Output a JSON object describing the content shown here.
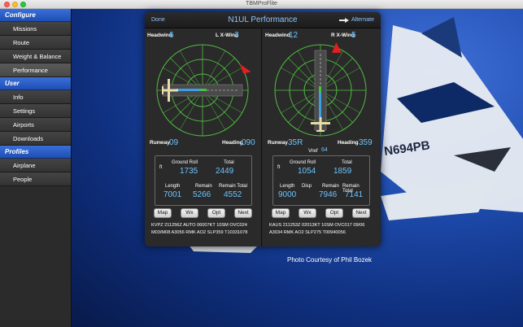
{
  "app": {
    "title": "TBMProFlite"
  },
  "sidebar": {
    "sections": [
      {
        "header": "Configure",
        "items": [
          "Missions",
          "Route",
          "Weight & Balance",
          "Performance"
        ]
      },
      {
        "header": "User",
        "items": [
          "Info",
          "Settings",
          "Airports",
          "Downloads"
        ]
      },
      {
        "header": "Profiles",
        "items": [
          "Airplane",
          "People"
        ]
      }
    ],
    "active_item": "Performance"
  },
  "background": {
    "caption": "Photo Courtesy of Phil Bozek"
  },
  "panel": {
    "done": "Done",
    "title": "N1UL Performance",
    "alternate": "Alternate",
    "left": {
      "headwind_label": "Headwind",
      "headwind": "6",
      "xwind_label": "L X-Wind",
      "xwind": "3",
      "runway_label": "Runway",
      "runway": "09",
      "heading_label": "Heading",
      "heading": "090",
      "unit": "ft",
      "ground_roll_label": "Ground Roll",
      "ground_roll": "1735",
      "total_label": "Total",
      "total": "2449",
      "length_label": "Length",
      "length": "7001",
      "remain_label": "Remain",
      "remain": "5266",
      "remain_total_label": "Remain Total",
      "remain_total": "4552",
      "metar": "KVPZ 211256Z AUTO 06007KT 10SM OVC024\nM03/M08 A3056 RMK AO2 SLP359 T10331078"
    },
    "right": {
      "headwind_label": "Headwind",
      "headwind": "12",
      "xwind_label": "R X-Wind",
      "xwind": "5",
      "runway_label": "Runway",
      "runway": "35R",
      "heading_label": "Heading",
      "heading": "359",
      "vref_label": "Vref",
      "vref": "64",
      "unit": "ft",
      "ground_roll_label": "Ground Roll",
      "ground_roll": "1054",
      "total_label": "Total",
      "total": "1859",
      "length_label": "Length",
      "length": "9000",
      "disp_label": "Disp",
      "remain_label": "Remain",
      "remain": "7946",
      "remain_total_label": "Remain Total",
      "remain_total": "7141",
      "metar": "KAUS 211253Z 02013KT 10SM OVC017 09/06\nA3034 RMK AO2 SLP275 T00940056"
    },
    "buttons": [
      "Map",
      "Wx",
      "Opt",
      "Next"
    ]
  },
  "colors": {
    "accent": "#6cc4ff",
    "compass": "#4fbf3f",
    "wind_arrow": "#e02020"
  },
  "icons": [
    "pointer-hand-icon",
    "wind-arrow-icon",
    "airplane-icon"
  ]
}
